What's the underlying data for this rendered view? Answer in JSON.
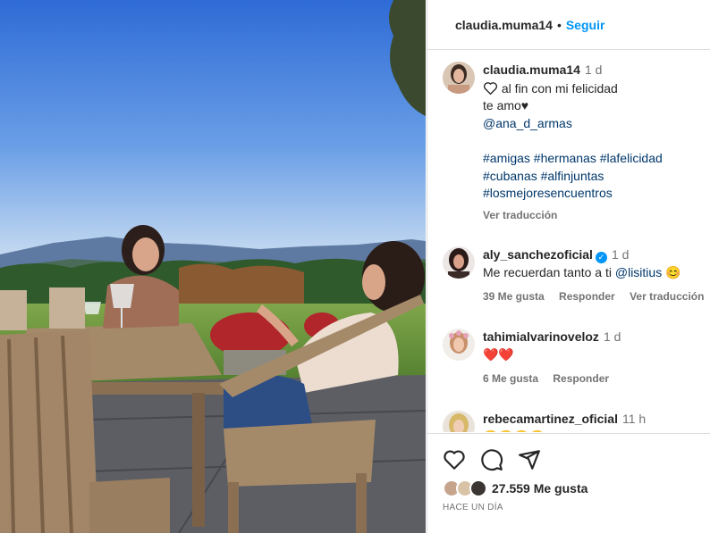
{
  "post": {
    "author": "claudia.muma14",
    "follow_label": "Seguir",
    "separator": "•"
  },
  "caption": {
    "user": "claudia.muma14",
    "time": "1 d",
    "line1": "al fin con mi felicidad",
    "line2": "te amo♥",
    "mention": "@ana_d_armas",
    "hashtags1": "#amigas #hermanas #lafelicidad",
    "hashtags2": "#cubanas #alfinjuntas",
    "hashtags3": "#losmejoresencuentros",
    "translate": "Ver traducción",
    "heart_icon": "heart-outline-icon"
  },
  "comments": [
    {
      "user": "aly_sanchezoficial",
      "verified": true,
      "time": "1 d",
      "text": "Me recuerdan tanto a ti",
      "mention": "@lisitius",
      "emoji": "😊",
      "likes": "39 Me gusta",
      "reply": "Responder",
      "translate": "Ver traducción"
    },
    {
      "user": "tahimialvarinoveloz",
      "time": "1 d",
      "text": "❤️❤️",
      "likes": "6 Me gusta",
      "reply": "Responder"
    },
    {
      "user": "rebecamartinez_oficial",
      "time": "11 h",
      "text": "😍😍😍😍"
    }
  ],
  "footer": {
    "likes": "27.559 Me gusta",
    "ago": "HACE UN DÍA",
    "icons": [
      "heart-icon",
      "comment-icon",
      "share-icon"
    ]
  },
  "colors": {
    "link": "#0095f6",
    "mention": "#00376b",
    "secondary": "#737373",
    "border": "#dbdbdb"
  }
}
